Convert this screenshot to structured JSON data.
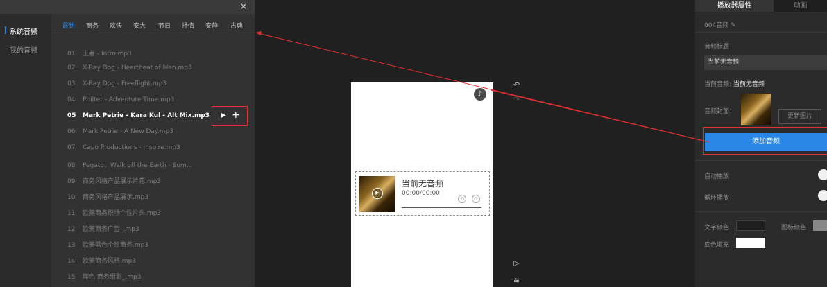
{
  "dialog": {
    "close_glyph": "×",
    "categories": [
      {
        "label": "系统音频",
        "active": true
      },
      {
        "label": "我的音频",
        "active": false
      }
    ],
    "genres": [
      "最新",
      "商务",
      "欢快",
      "安大",
      "节日",
      "抒情",
      "安静",
      "古典"
    ],
    "active_genre": "最新",
    "songs": [
      {
        "num": "01",
        "title": "王者 - Intro.mp3"
      },
      {
        "num": "02",
        "title": "X-Ray Dog - Heartbeat of Man.mp3"
      },
      {
        "num": "03",
        "title": "X-Ray Dog - Freeflight.mp3"
      },
      {
        "num": "04",
        "title": "Philter - Adventure Time.mp3"
      },
      {
        "num": "05",
        "title": "Mark Petrie - Kara Kul - Alt Mix.mp3",
        "highlighted": true
      },
      {
        "num": "06",
        "title": "Mark Petrie - A New Day.mp3"
      },
      {
        "num": "07",
        "title": "Capo Productions - Inspire.mp3"
      },
      {
        "num": "08",
        "title": "Pegato、Walk off the Earth - Sum..."
      },
      {
        "num": "09",
        "title": "商务风格产品展示片花.mp3"
      },
      {
        "num": "10",
        "title": "商务风格产品展示.mp3"
      },
      {
        "num": "11",
        "title": "欧美商务职场个性片头.mp3"
      },
      {
        "num": "12",
        "title": "欧美商务广告_.mp3"
      },
      {
        "num": "13",
        "title": "欧美蓝色个性商务.mp3"
      },
      {
        "num": "14",
        "title": "欧美商务风格.mp3"
      },
      {
        "num": "15",
        "title": "蓝色 商务组影_.mp3"
      }
    ],
    "song_actions": {
      "play_glyph": "▶",
      "add_glyph": "+"
    }
  },
  "canvas": {
    "note_glyph": "♪",
    "player": {
      "title": "当前无音频",
      "time": "00:00/00:00",
      "play_glyph": "▶"
    },
    "tools": {
      "undo": "↶",
      "redo": "↷",
      "preview": "▷",
      "layers": "≋"
    }
  },
  "props": {
    "tabs": [
      "播放器属性",
      "动画"
    ],
    "name": "004音频",
    "edit_glyph": "✎",
    "audio_title_label": "音频标题",
    "audio_title_value": "当前无音频",
    "current_audio_label": "当前音频:",
    "current_audio_value": "当前无音频",
    "cover_label": "音频封面：",
    "update_image_button": "更新图片",
    "add_audio_button": "添加音频",
    "autoplay_label": "自动播放",
    "loop_label": "循环播放",
    "text_color_label": "文字颜色",
    "icon_color_label": "图标颜色",
    "bg_fill_label": "底色填充"
  },
  "colors": {
    "accent": "#2a87e8",
    "highlight_box": "#e03030",
    "panel_bg": "#2b2b2b",
    "canvas_bg": "#202020"
  }
}
